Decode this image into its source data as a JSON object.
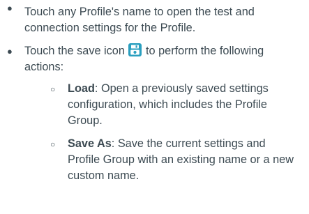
{
  "bullets": [
    {
      "text": "Touch any Profile's name to open the test and connection settings for the Profile."
    },
    {
      "text_before_icon": "Touch the save icon",
      "icon": "save-icon",
      "text_after_icon": "to perform the following actions:",
      "sub_items": [
        {
          "term": "Load",
          "description": ": Open a previously saved settings configuration, which includes the Profile Group."
        },
        {
          "term": "Save As",
          "description": ": Save the current settings and Profile Group with an existing name or a new custom name."
        }
      ]
    }
  ],
  "colors": {
    "text": "#3c4a52",
    "icon_bg": "#2a9fbf"
  }
}
